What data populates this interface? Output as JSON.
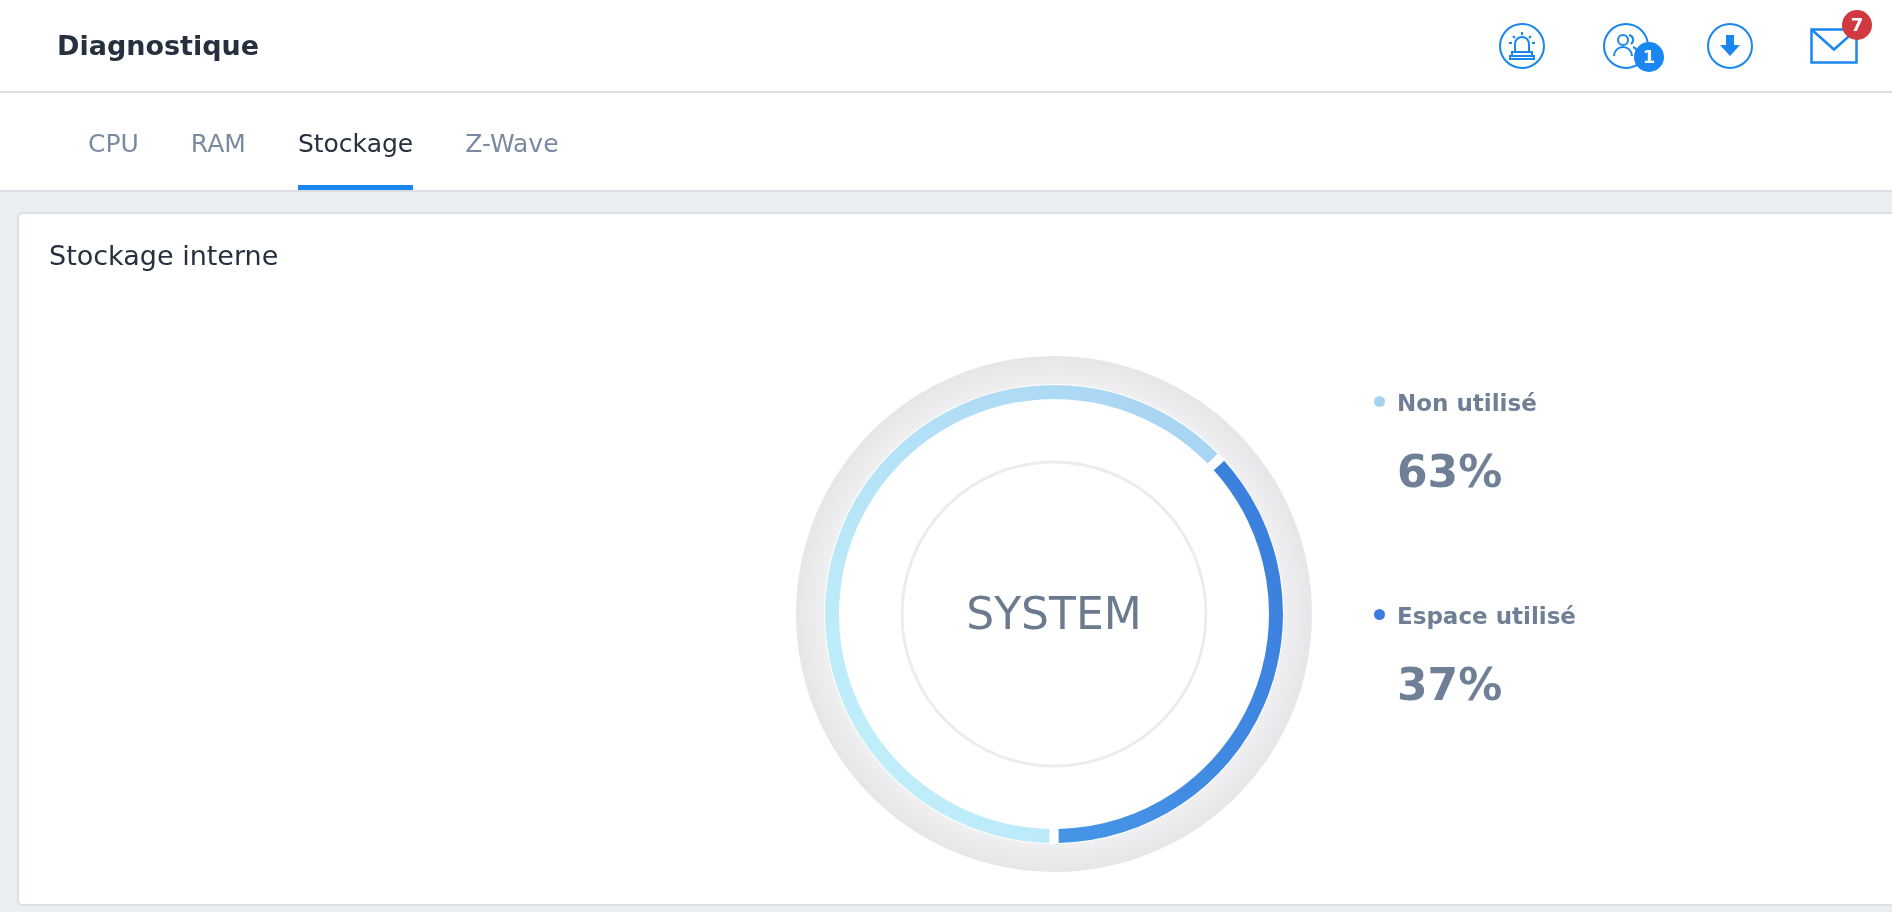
{
  "header": {
    "title": "Diagnostique",
    "users_badge": "1",
    "mail_badge": "7"
  },
  "tabs": [
    {
      "label": "CPU",
      "selected": false
    },
    {
      "label": "RAM",
      "selected": false
    },
    {
      "label": "Stockage",
      "selected": true
    },
    {
      "label": "Z-Wave",
      "selected": false
    }
  ],
  "card": {
    "title": "Stockage interne",
    "center_label": "SYSTEM",
    "legend": [
      {
        "value": "63%",
        "color": "#a6d2f2"
      },
      {
        "value": "37%",
        "color": "#3b7ddd"
      }
    ],
    "chart_data": {
      "type": "donut",
      "categories": [
        "Non utilisé",
        "Espace utilisé"
      ],
      "values": [
        63,
        37
      ]
    }
  }
}
